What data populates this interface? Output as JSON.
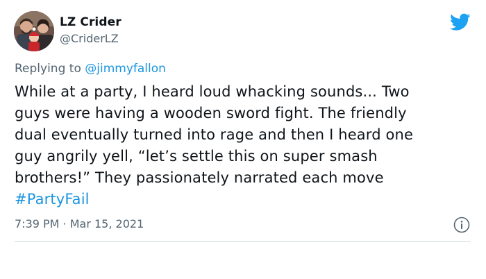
{
  "author": {
    "display_name": "LZ Crider",
    "handle": "@CriderLZ",
    "avatar_icon": "family-photo-avatar"
  },
  "platform_icon": "twitter-bird-icon",
  "reply": {
    "prefix": "Replying to",
    "mention": "@jimmyfallon"
  },
  "tweet": {
    "lines": [
      "While at a party, I heard loud whacking sounds... Two",
      "guys were having a wooden sword fight. The friendly",
      "dual eventually turned into rage and then I heard one",
      "guy angrily yell, “let’s settle this on super smash",
      "brothers!” They passionately narrated each move"
    ],
    "hashtag": "#PartyFail"
  },
  "meta": {
    "time": "7:39 PM · Mar 15, 2021",
    "info_icon": "info-icon"
  },
  "colors": {
    "link": "#1b95e0",
    "text": "#0f1419",
    "secondary": "#536471",
    "twitter_blue": "#1da1f2",
    "divider": "#cfd9de"
  }
}
